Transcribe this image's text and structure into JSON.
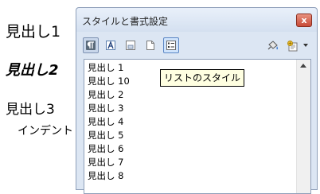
{
  "document": {
    "heading1": "見出し1",
    "heading2": "見出し2",
    "heading3": "見出し3",
    "indent": "インデント"
  },
  "panel": {
    "title": "スタイルと書式設定",
    "close_label": "x"
  },
  "toolbar": {
    "buttons": [
      {
        "icon": "paragraph-styles-icon",
        "state": "active"
      },
      {
        "icon": "character-styles-icon",
        "state": "normal"
      },
      {
        "icon": "frame-styles-icon",
        "state": "normal"
      },
      {
        "icon": "page-styles-icon",
        "state": "normal"
      },
      {
        "icon": "list-styles-icon",
        "state": "hover"
      },
      {
        "icon": "fill-format-mode-icon",
        "state": "normal"
      },
      {
        "icon": "new-style-from-selection-icon",
        "state": "normal"
      }
    ]
  },
  "styles_list": {
    "items": [
      "見出し 1",
      "見出し 10",
      "見出し 2",
      "見出し 3",
      "見出し 4",
      "見出し 5",
      "見出し 6",
      "見出し 7",
      "見出し 8"
    ]
  },
  "tooltip": {
    "text": "リストのスタイル"
  }
}
